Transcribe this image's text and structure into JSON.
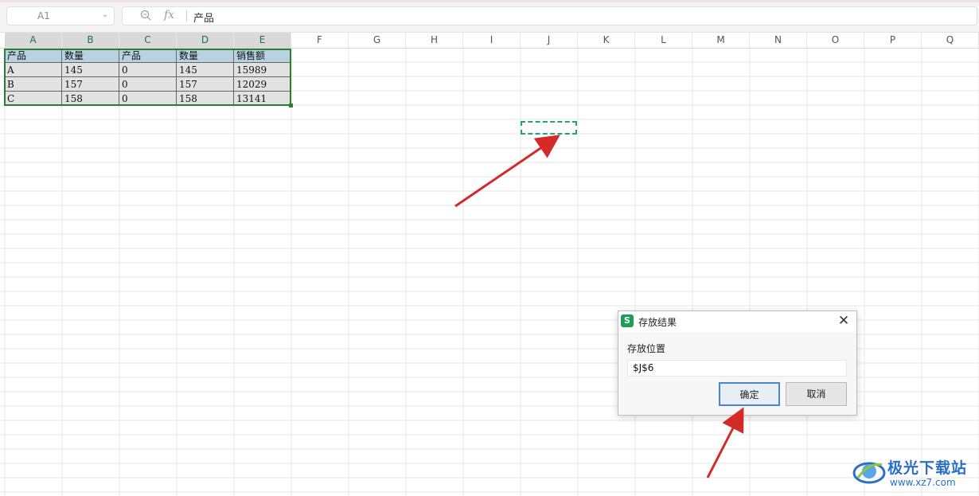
{
  "formula_bar": {
    "name_box": "A1",
    "fx_label": "fx",
    "formula_text": "产品"
  },
  "columns": [
    "A",
    "B",
    "C",
    "D",
    "E",
    "F",
    "G",
    "H",
    "I",
    "J",
    "K",
    "L",
    "M",
    "N",
    "O",
    "P",
    "Q"
  ],
  "selected_columns": [
    "A",
    "B",
    "C",
    "D",
    "E"
  ],
  "table": {
    "headers": [
      "产品",
      "数量",
      "产品",
      "数量",
      "销售额"
    ],
    "rows": [
      [
        "A",
        "145",
        "0",
        "145",
        "15989"
      ],
      [
        "B",
        "157",
        "0",
        "157",
        "12029"
      ],
      [
        "C",
        "158",
        "0",
        "158",
        "13141"
      ]
    ]
  },
  "dialog": {
    "icon_letter": "S",
    "title": "存放结果",
    "close_glyph": "✕",
    "field_label": "存放位置",
    "field_value": "$J$6",
    "ok_label": "确定",
    "cancel_label": "取消"
  },
  "watermark": {
    "brand": "极光下载站",
    "url": "www.xz7.com"
  },
  "colors": {
    "header_fill": "#b7d2e1",
    "body_fill": "#e2e2e2",
    "selection": "#2e7d32",
    "marquee": "#24a07a",
    "arrow": "#d42a2a",
    "brand": "#2a6fc5"
  }
}
